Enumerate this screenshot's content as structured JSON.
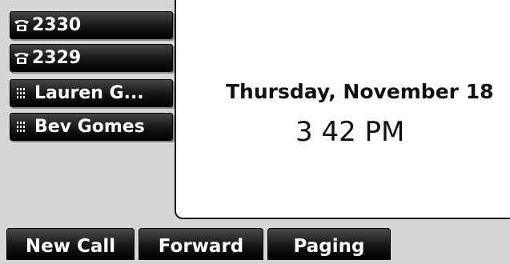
{
  "line_keys": [
    {
      "label": "2330",
      "icon": "phone-icon"
    },
    {
      "label": "2329",
      "icon": "phone-icon"
    },
    {
      "label": "Lauren G...",
      "icon": "speed-dial-grid-icon"
    },
    {
      "label": "Bev Gomes",
      "icon": "speed-dial-grid-icon"
    }
  ],
  "main": {
    "date": "Thursday, November 18",
    "time": "3 42 PM"
  },
  "soft_keys": [
    {
      "label": "New Call"
    },
    {
      "label": "Forward"
    },
    {
      "label": "Paging"
    }
  ],
  "colors": {
    "key_background": "#1a1a1a",
    "panel_background": "#ffffff",
    "screen_background": "#d6d6d6"
  }
}
